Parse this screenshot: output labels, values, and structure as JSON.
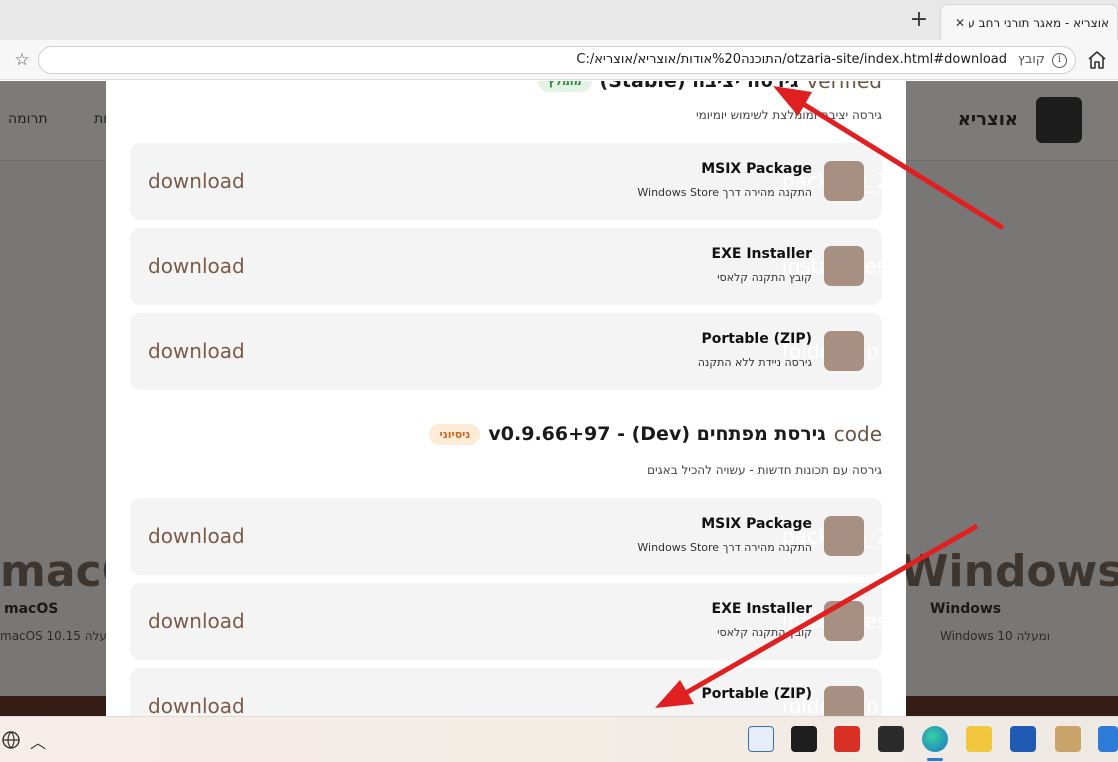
{
  "browser": {
    "tab_title": "אוצריא - מאגר תורני רחב עם ממשק",
    "url": "C:/התוכנה%20אודות/אוצריא/אוצריא/otzaria-site/index.html#download",
    "file_label": "קובץ"
  },
  "background_page": {
    "brand": "אוצריא",
    "nav_links": [
      "תרומה",
      "תכונות"
    ],
    "windows_title": "Windows",
    "windows_sub": "Windows",
    "windows_sub2": "Windows 10 ומעלה",
    "mac_title": "macOS",
    "mac_sub": "macOS",
    "mac_sub2": "macOS 10.15 ומעלה"
  },
  "modal": {
    "stable": {
      "glyph": "verified",
      "title": "גירסה יציבה (Stable)",
      "badge": "מומלץ",
      "description": "גירסה יציבה ומומלצת לשימוש יומיומי",
      "cards": [
        {
          "icon_text": "package_2",
          "name": "MSIX Package",
          "desc": "התקנה מהירה דרך Windows Store",
          "action": "download"
        },
        {
          "icon_text": "install_desktop",
          "name": "EXE Installer",
          "desc": "קובץ התקנה קלאסי",
          "action": "download"
        },
        {
          "icon_text": "folder_zip",
          "name": "Portable (ZIP)",
          "desc": "גירסה ניידת ללא התקנה",
          "action": "download"
        }
      ]
    },
    "dev": {
      "glyph": "code",
      "title": "גירסת מפתחים (Dev) - v0.9.66+97",
      "badge": "ניסיוני",
      "description": "גירסה עם תכונות חדשות - עשויה להכיל באגים",
      "cards": [
        {
          "icon_text": "package_2",
          "name": "MSIX Package",
          "desc": "התקנה מהירה דרך Windows Store",
          "action": "download"
        },
        {
          "icon_text": "install_desktop",
          "name": "EXE Installer",
          "desc": "קובץ התקנה קלאסי",
          "action": "download"
        },
        {
          "icon_text": "folder_zip",
          "name": "Portable (ZIP)",
          "desc": "",
          "action": "download"
        }
      ]
    }
  },
  "colors": {
    "accent_brown": "#7a5b4b",
    "icon_box": "#a78f82",
    "arrow_red": "#e02020"
  }
}
